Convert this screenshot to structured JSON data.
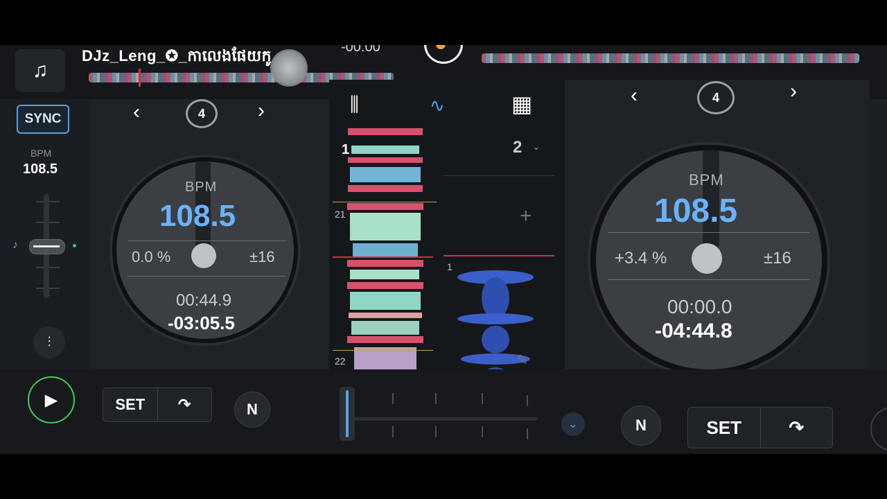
{
  "topbar": {
    "music_icon": "music-note-icon",
    "track_title": "DJz_Leng_✪_កាលេងផែយកូ_...",
    "elapsed_top": "-00:00"
  },
  "left_strip": {
    "sync_label": "SYNC",
    "bpm_label": "BPM",
    "bpm_value": "108.5",
    "mixer_icon": "mixer-sliders-icon"
  },
  "deck_left": {
    "loop_value": "4",
    "bpm_label": "BPM",
    "bpm_value": "108.5",
    "pitch": "0.0 %",
    "range": "±16",
    "elapsed": "00:44.9",
    "remaining": "-03:05.5"
  },
  "deck_right": {
    "loop_value": "4",
    "bpm_label": "BPM",
    "bpm_value": "108.5",
    "pitch": "+3.4 %",
    "range": "±16",
    "elapsed": "00:00.0",
    "remaining": "-04:44.8"
  },
  "center": {
    "tabs": [
      "mixer-icon",
      "waveform-icon",
      "grid-icon"
    ],
    "left_marker_top": "1",
    "left_marker_mid": "21",
    "left_marker_bot": "22",
    "right_deck_number": "2",
    "right_marker": "1",
    "add_symbol": "+"
  },
  "bottombar": {
    "set_left": "SET",
    "set_right": "SET",
    "n_label": "N"
  },
  "colors": {
    "accent_blue": "#4fa3e8",
    "bpm_blue": "#6ab2ff",
    "play_green": "#3ecf5b",
    "cue_orange": "#f1a43a"
  }
}
